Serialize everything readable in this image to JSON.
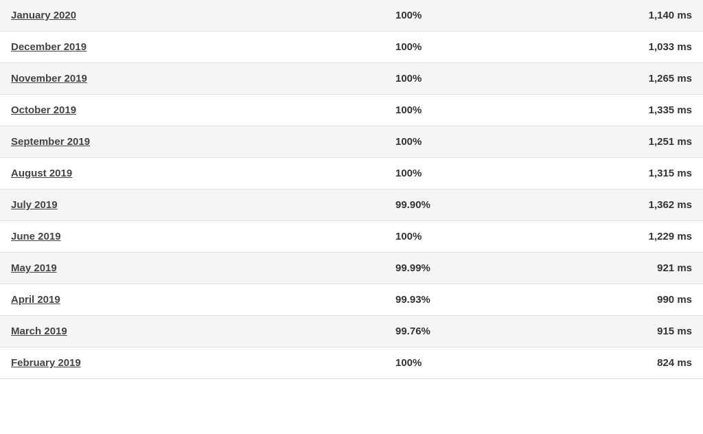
{
  "rows": [
    {
      "month": "January 2020",
      "uptime": "100%",
      "response": "1,140 ms"
    },
    {
      "month": "December 2019",
      "uptime": "100%",
      "response": "1,033 ms"
    },
    {
      "month": "November 2019",
      "uptime": "100%",
      "response": "1,265 ms"
    },
    {
      "month": "October 2019",
      "uptime": "100%",
      "response": "1,335 ms"
    },
    {
      "month": "September 2019",
      "uptime": "100%",
      "response": "1,251 ms"
    },
    {
      "month": "August 2019",
      "uptime": "100%",
      "response": "1,315 ms"
    },
    {
      "month": "July 2019",
      "uptime": "99.90%",
      "response": "1,362 ms"
    },
    {
      "month": "June 2019",
      "uptime": "100%",
      "response": "1,229 ms"
    },
    {
      "month": "May 2019",
      "uptime": "99.99%",
      "response": "921 ms"
    },
    {
      "month": "April 2019",
      "uptime": "99.93%",
      "response": "990 ms"
    },
    {
      "month": "March 2019",
      "uptime": "99.76%",
      "response": "915 ms"
    },
    {
      "month": "February 2019",
      "uptime": "100%",
      "response": "824 ms"
    }
  ]
}
